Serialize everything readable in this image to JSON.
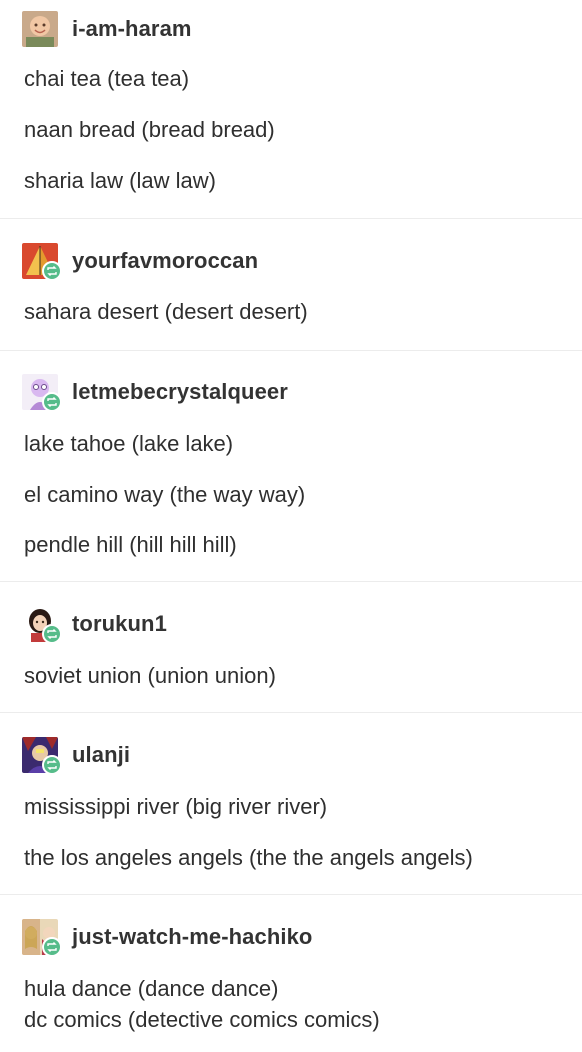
{
  "posts": [
    {
      "username": "i-am-haram",
      "avatar_icon": "baby-photo-icon",
      "reblog": false,
      "lines": [
        "chai tea (tea tea)",
        "naan bread (bread bread)",
        "sharia law (law law)"
      ]
    },
    {
      "username": "yourfavmoroccan",
      "avatar_icon": "pyramid-art-icon",
      "reblog": true,
      "lines": [
        "sahara desert (desert desert)"
      ]
    },
    {
      "username": "letmebecrystalqueer",
      "avatar_icon": "cartoon-character-icon",
      "reblog": true,
      "lines": [
        "lake tahoe (lake lake)",
        "el camino way (the way way)",
        "pendle hill (hill hill hill)"
      ]
    },
    {
      "username": "torukun1",
      "avatar_icon": "anime-girl-icon",
      "reblog": true,
      "lines": [
        "soviet union (union union)"
      ]
    },
    {
      "username": "ulanji",
      "avatar_icon": "anime-character-icon",
      "reblog": true,
      "lines": [
        "mississippi river (big river river)",
        "the los angeles angels (the the angels angels)"
      ]
    },
    {
      "username": "just-watch-me-hachiko",
      "avatar_icon": "photo-collage-icon",
      "reblog": true,
      "lines": [
        "hula dance (dance dance)",
        "dc comics (detective comics comics)"
      ]
    }
  ],
  "colors": {
    "reblog_badge": "#56bc8a",
    "divider": "#ececec",
    "text": "#2f2f2f"
  }
}
